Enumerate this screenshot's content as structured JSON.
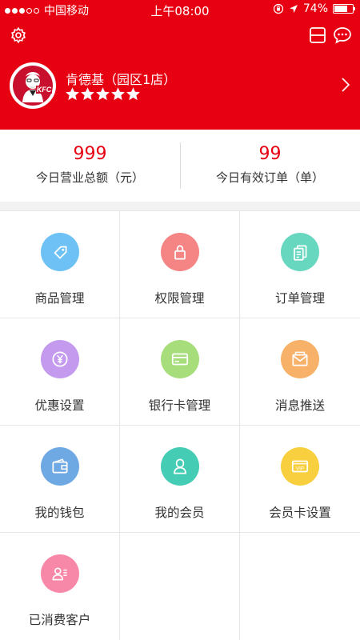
{
  "status_bar": {
    "carrier": "中国移动",
    "time": "上午08:00",
    "battery": "74%",
    "battery_level": 0.74
  },
  "colors": {
    "brand": "#e60012"
  },
  "store": {
    "name": "肯德基（园区1店）",
    "rating": 5,
    "rating_max": 5,
    "logo": "kfc-logo"
  },
  "stats": [
    {
      "value": "999",
      "label": "今日营业总额（元）"
    },
    {
      "value": "99",
      "label": "今日有效订单（单）"
    }
  ],
  "menu": [
    {
      "label": "商品管理",
      "icon": "tag-icon",
      "color": "#6ec1f5"
    },
    {
      "label": "权限管理",
      "icon": "lock-icon",
      "color": "#f58585"
    },
    {
      "label": "订单管理",
      "icon": "document-icon",
      "color": "#67d7c0"
    },
    {
      "label": "优惠设置",
      "icon": "yen-icon",
      "color": "#c49aef"
    },
    {
      "label": "银行卡管理",
      "icon": "card-icon",
      "color": "#a8dd7c"
    },
    {
      "label": "消息推送",
      "icon": "envelope-icon",
      "color": "#f8b168"
    },
    {
      "label": "我的钱包",
      "icon": "wallet-icon",
      "color": "#6fa9e4"
    },
    {
      "label": "我的会员",
      "icon": "user-icon",
      "color": "#45ccb4"
    },
    {
      "label": "会员卡设置",
      "icon": "vip-card-icon",
      "color": "#f8cf3f"
    },
    {
      "label": "已消费客户",
      "icon": "customer-list-icon",
      "color": "#f888a8"
    }
  ]
}
